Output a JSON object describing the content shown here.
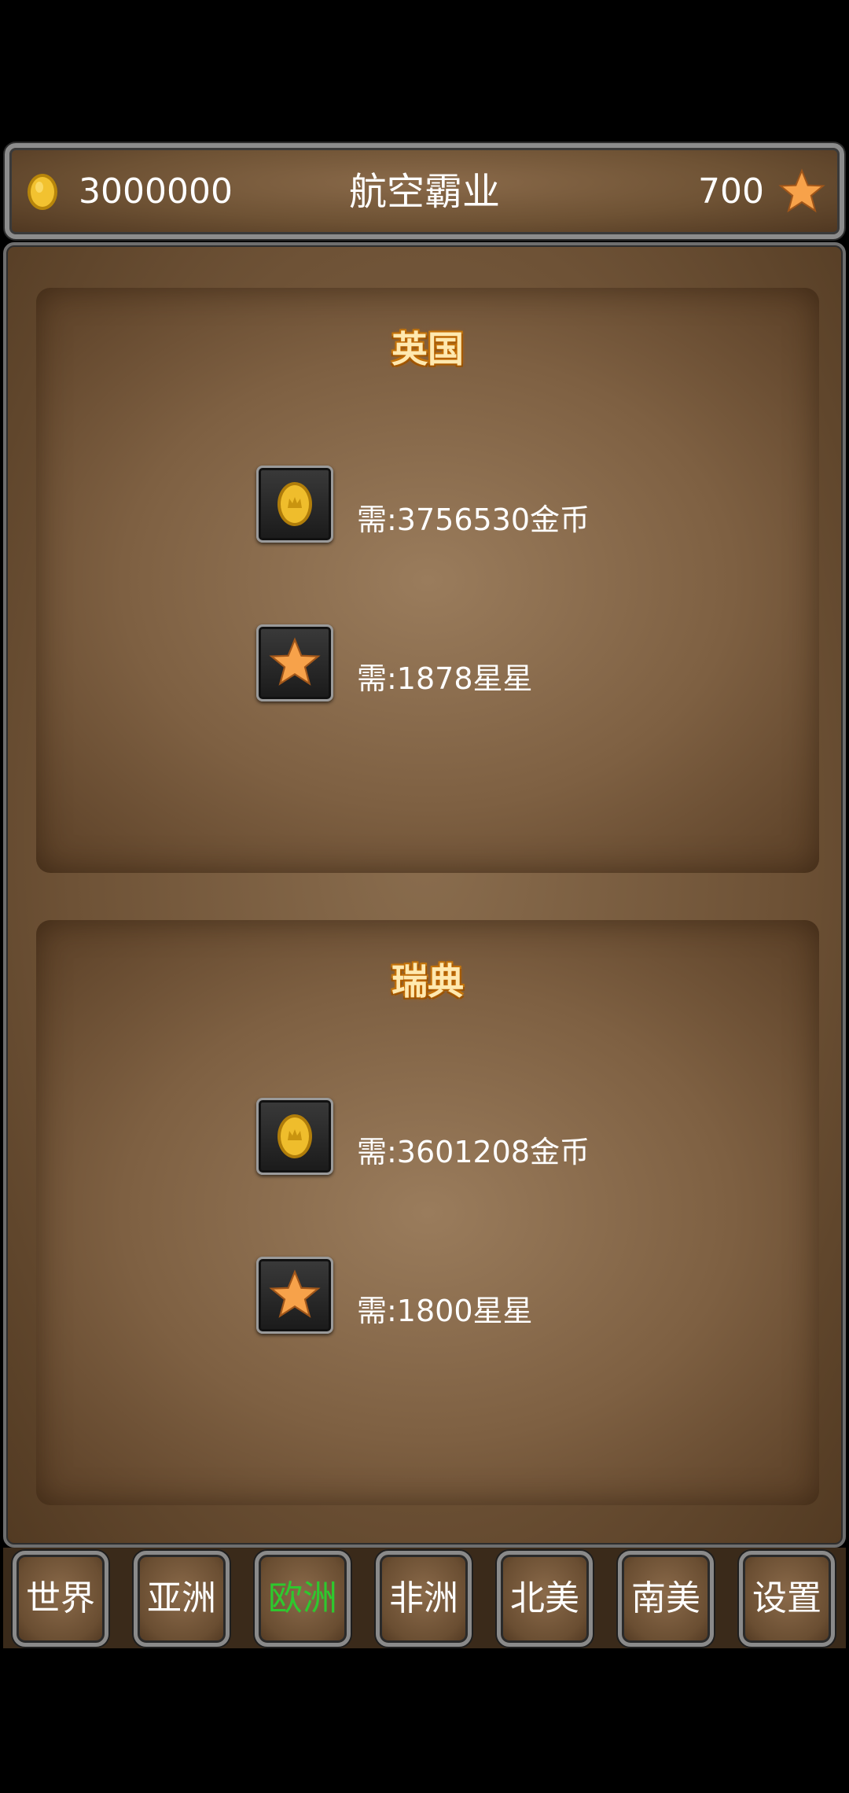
{
  "header": {
    "gold_amount": "3000000",
    "title": "航空霸业",
    "star_amount": "700"
  },
  "countries": [
    {
      "name": "英国",
      "gold_requirement": "需:3756530金币",
      "star_requirement": "需:1878星星"
    },
    {
      "name": "瑞典",
      "gold_requirement": "需:3601208金币",
      "star_requirement": "需:1800星星"
    }
  ],
  "tabs": [
    {
      "label": "世界",
      "active": false
    },
    {
      "label": "亚洲",
      "active": false
    },
    {
      "label": "欧洲",
      "active": true
    },
    {
      "label": "非洲",
      "active": false
    },
    {
      "label": "北美",
      "active": false
    },
    {
      "label": "南美",
      "active": false
    },
    {
      "label": "设置",
      "active": false
    }
  ],
  "colors": {
    "active_tab": "#2ec82e",
    "country_name": "#ffe9b0",
    "star": "#f7a24a",
    "coin": "#e8b21a"
  },
  "icons": {
    "coin": "gold-coin-icon",
    "star": "star-icon"
  }
}
